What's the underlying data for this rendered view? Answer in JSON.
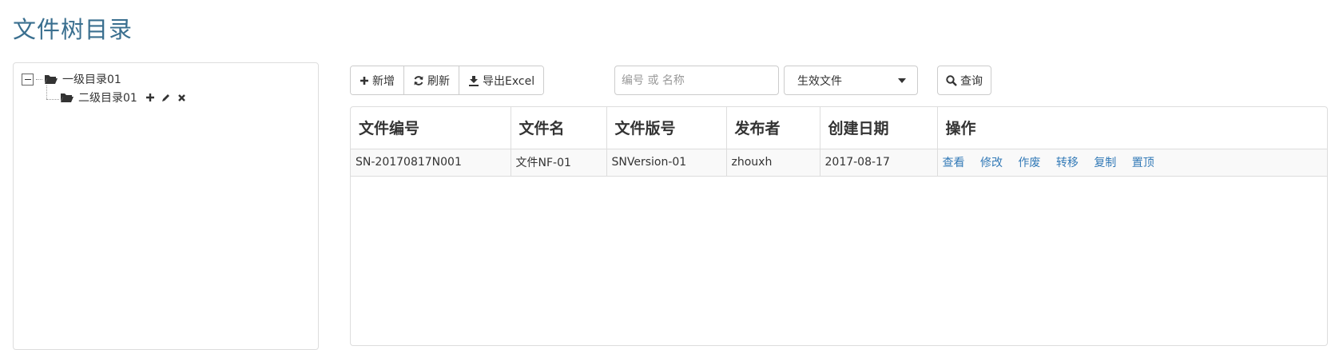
{
  "page": {
    "title": "文件树目录"
  },
  "tree": {
    "root": {
      "label": "一级目录01",
      "icon": "folder-open-icon",
      "collapse": "minus-box-icon"
    },
    "child": {
      "label": "二级目录01",
      "icon": "folder-open-icon",
      "actions": [
        "plus-icon",
        "pencil-icon",
        "close-icon"
      ]
    }
  },
  "toolbar": {
    "add_label": "新增",
    "refresh_label": "刷新",
    "export_label": "导出Excel"
  },
  "search": {
    "placeholder": "编号 或 名称",
    "value": "",
    "status_selected": "生效文件",
    "query_label": "查询"
  },
  "table": {
    "columns": [
      "文件编号",
      "文件名",
      "文件版号",
      "发布者",
      "创建日期",
      "操作"
    ],
    "rows": [
      {
        "file_no": "SN-20170817N001",
        "file_name": "文件NF-01",
        "version": "SNVersion-01",
        "publisher": "zhouxh",
        "created": "2017-08-17",
        "ops": [
          "查看",
          "修改",
          "作废",
          "转移",
          "复制",
          "置顶"
        ]
      }
    ]
  },
  "colors": {
    "title": "#3a6f8f",
    "link": "#337ab7",
    "border": "#dddddd"
  }
}
